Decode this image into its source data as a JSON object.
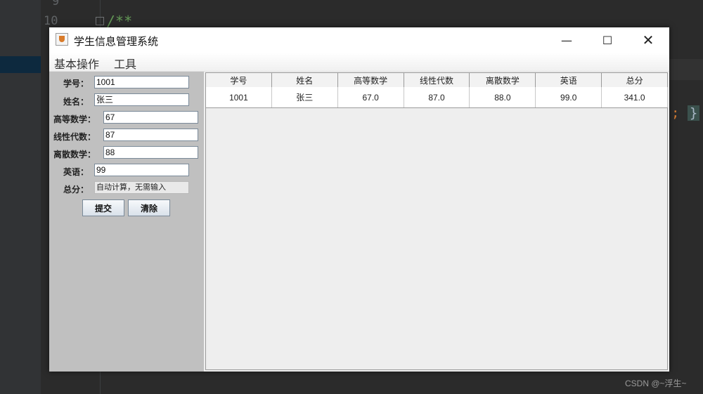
{
  "ide": {
    "line_number": "10",
    "line_number_prev": "9",
    "comment": "/**",
    "right_code_semicolon": ";",
    "right_code_brace": "}"
  },
  "window": {
    "title": "学生信息管理系统",
    "controls": {
      "minimize": "—",
      "maximize": "☐",
      "close": "✕"
    }
  },
  "menu": {
    "items": [
      "基本操作",
      "工具"
    ]
  },
  "form": {
    "fields": [
      {
        "label": "学号：",
        "value": "1001"
      },
      {
        "label": "姓名：",
        "value": "张三"
      },
      {
        "label": "高等数学：",
        "value": "67"
      },
      {
        "label": "线性代数：",
        "value": "87"
      },
      {
        "label": "离散数学：",
        "value": "88"
      },
      {
        "label": "英语：",
        "value": "99"
      },
      {
        "label": "总分：",
        "value": "自动计算，无需输入"
      }
    ],
    "submit_label": "提交",
    "clear_label": "清除"
  },
  "table": {
    "columns": [
      "学号",
      "姓名",
      "高等数学",
      "线性代数",
      "离散数学",
      "英语",
      "总分"
    ],
    "rows": [
      [
        "1001",
        "张三",
        "67.0",
        "87.0",
        "88.0",
        "99.0",
        "341.0"
      ]
    ]
  },
  "watermark": "CSDN @~浮生~"
}
